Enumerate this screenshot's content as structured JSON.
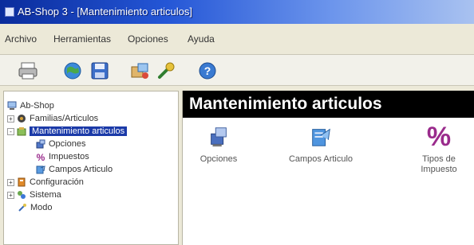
{
  "window": {
    "title": "AB-Shop 3 - [Mantenimiento articulos]"
  },
  "menu": [
    "Archivo",
    "Herramientas",
    "Opciones",
    "Ayuda"
  ],
  "toolbar": [
    {
      "icon": "printer-icon"
    },
    {
      "icon": "globe-icon"
    },
    {
      "icon": "disk-icon"
    },
    {
      "icon": "package-icon"
    },
    {
      "icon": "wrench-icon"
    },
    {
      "icon": "help-icon"
    }
  ],
  "tree": {
    "root": "Ab-Shop",
    "nodes": [
      {
        "label": "Familias/Articulos",
        "expander": "+",
        "icon": "folder-icon",
        "level": 1
      },
      {
        "label": "Mantenimiento articulos",
        "expander": "-",
        "icon": "tools-icon",
        "level": 1,
        "selected": true
      },
      {
        "label": "Opciones",
        "icon": "options-icon",
        "level": 2
      },
      {
        "label": "Impuestos",
        "icon": "percent-icon",
        "level": 2
      },
      {
        "label": "Campos Articulo",
        "icon": "fields-icon",
        "level": 2
      },
      {
        "label": "Configuración",
        "expander": "+",
        "icon": "settings-icon",
        "level": 1
      },
      {
        "label": "Sistema",
        "expander": "+",
        "icon": "system-icon",
        "level": 1
      },
      {
        "label": "Modo",
        "icon": "mode-icon",
        "level": 1
      }
    ]
  },
  "content": {
    "heading": "Mantenimiento articulos",
    "items": [
      {
        "label": "Opciones",
        "icon": "options-icon"
      },
      {
        "label": "Campos Articulo",
        "icon": "fields-icon"
      },
      {
        "label": "Tipos de Impuesto",
        "icon": "percent-icon",
        "glyph": "%"
      }
    ]
  },
  "colors": {
    "title_bar": "#1e48c8",
    "selection": "#1b3aa8",
    "header": "#000000",
    "percent_icon": "#9a2b8c"
  }
}
